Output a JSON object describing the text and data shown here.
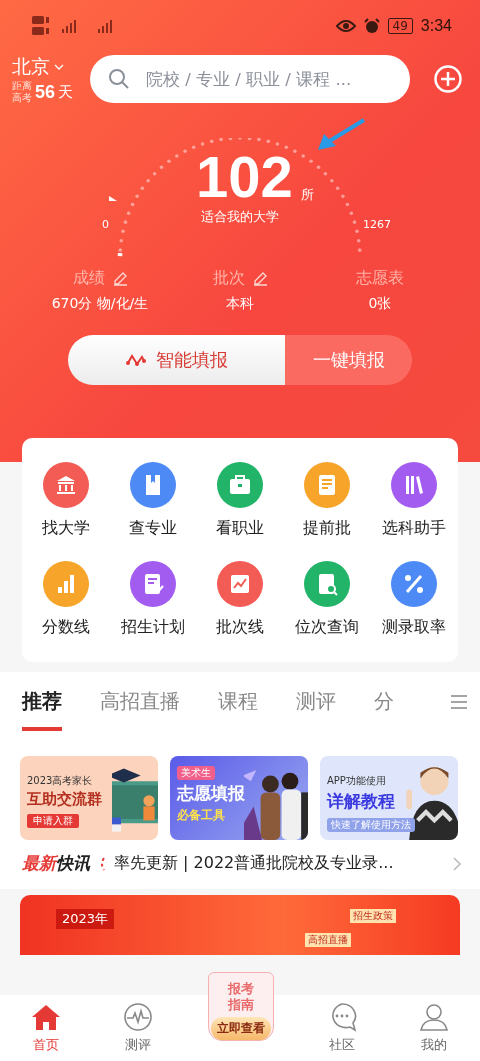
{
  "status_bar": {
    "battery": "49",
    "time": "3:34"
  },
  "header": {
    "city": "北京",
    "countdown_label_1": "距离",
    "countdown_label_2": "高考",
    "countdown_days": "56",
    "countdown_unit": "天",
    "search": {
      "placeholder": "院校 / 专业 / 职业 / 课程 ..."
    }
  },
  "gauge": {
    "count": "102",
    "unit": "所",
    "caption": "适合我的大学",
    "min": "0",
    "max": "1267",
    "level": 0.08
  },
  "stats": [
    {
      "label": "成绩",
      "value": "670分 物/化/生",
      "editable": true
    },
    {
      "label": "批次",
      "value": "本科",
      "editable": true
    },
    {
      "label": "志愿表",
      "value": "0张",
      "editable": false
    }
  ],
  "fill_buttons": [
    {
      "label": "智能填报",
      "selected": true
    },
    {
      "label": "一键填报",
      "selected": false
    }
  ],
  "tools": [
    {
      "label": "找大学",
      "kind": "bank",
      "color": "#f25c54"
    },
    {
      "label": "查专业",
      "kind": "book",
      "color": "#4d8af5"
    },
    {
      "label": "看职业",
      "kind": "briefcase",
      "color": "#22b468"
    },
    {
      "label": "提前批",
      "kind": "doc",
      "color": "#f7a42a"
    },
    {
      "label": "选科助手",
      "kind": "books",
      "color": "#a35cf0"
    },
    {
      "label": "分数线",
      "kind": "bars",
      "color": "#f7a42a"
    },
    {
      "label": "招生计划",
      "kind": "check",
      "color": "#a35cf0"
    },
    {
      "label": "批次线",
      "kind": "chart",
      "color": "#f25c54"
    },
    {
      "label": "位次查询",
      "kind": "search",
      "color": "#22b468"
    },
    {
      "label": "测录取率",
      "kind": "percent",
      "color": "#4d8af5"
    }
  ],
  "tabs": [
    {
      "label": "推荐",
      "selected": true
    },
    {
      "label": "高招直播",
      "selected": false
    },
    {
      "label": "课程",
      "selected": false
    },
    {
      "label": "测评",
      "selected": false
    },
    {
      "label": "分",
      "selected": false
    }
  ],
  "banners": [
    {
      "kind": "group",
      "line_1": "2023高考家长",
      "line_2": "互助交流群",
      "tag": "申请入群"
    },
    {
      "kind": "art",
      "line_1": "美术生",
      "line_2": "志愿填报",
      "tag": "必备工具"
    },
    {
      "kind": "tutorial",
      "line_1": "APP功能使用",
      "line_2": "详解教程",
      "tag": "快速了解使用方法"
    }
  ],
  "news": {
    "brand_1": "最新",
    "brand_2": "快讯",
    "text": "率先更新 | 2022普通批院校及专业录..."
  },
  "promo": {
    "year": "2023年",
    "tag_1": "招生政策",
    "tag_2": "高招直播"
  },
  "float_badge": {
    "line_1": "报考",
    "line_2": "指南",
    "button": "立即查看"
  },
  "nav": [
    {
      "label": "首页",
      "kind": "home",
      "selected": true
    },
    {
      "label": "测评",
      "kind": "pulse",
      "selected": false
    },
    {
      "label": "社区",
      "kind": "chat",
      "selected": false
    },
    {
      "label": "我的",
      "kind": "user",
      "selected": false
    }
  ]
}
